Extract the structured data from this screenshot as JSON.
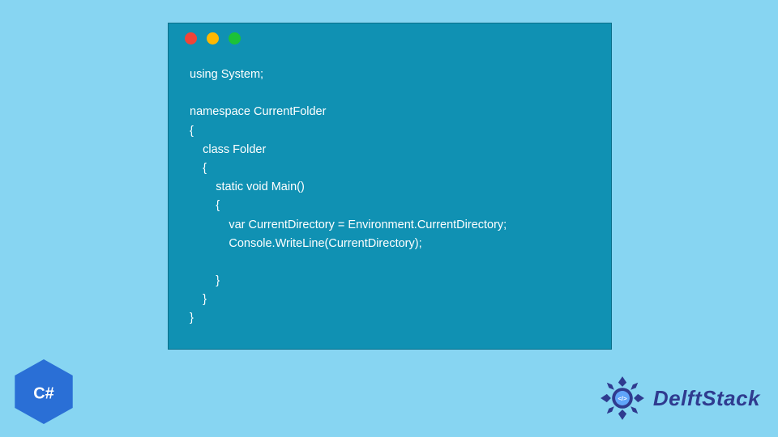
{
  "colors": {
    "background": "#87d5f2",
    "window_bg": "#1091b3",
    "dot_red": "#f04438",
    "dot_yellow": "#ffb800",
    "dot_green": "#1cc238",
    "code_text": "#ffffff",
    "brand_text": "#2f3b8f",
    "badge_fill": "#2a6fd6"
  },
  "code": {
    "language": "csharp",
    "lines": "using System;\n\nnamespace CurrentFolder\n{\n    class Folder\n    {\n        static void Main()\n        {\n            var CurrentDirectory = Environment.CurrentDirectory;\n            Console.WriteLine(CurrentDirectory);\n\n        }\n    }\n}"
  },
  "badge": {
    "label": "C#"
  },
  "brand": {
    "name": "DelftStack"
  }
}
